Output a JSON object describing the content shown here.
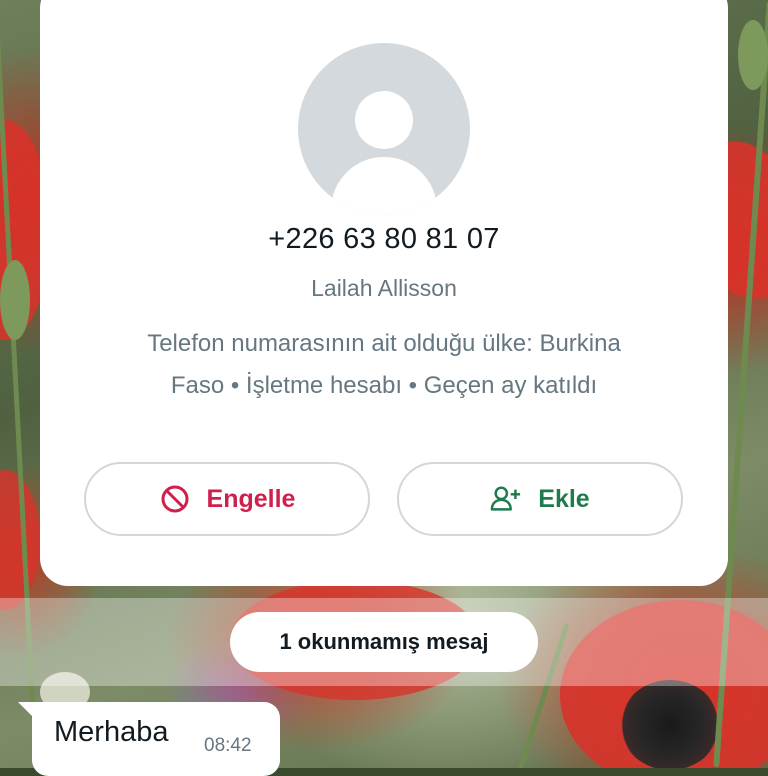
{
  "contact": {
    "phone": "+226 63 80 81 07",
    "push_name": "Lailah Allisson",
    "info_line_1": "Telefon numarasının ait olduğu ülke: Burkina",
    "info_line_2": "Faso • İşletme hesabı • Geçen ay katıldı"
  },
  "actions": {
    "block_label": "Engelle",
    "block_icon": "block-icon",
    "add_label": "Ekle",
    "add_icon": "person-add-icon"
  },
  "unread_banner": {
    "text": "1 okunmamış mesaj"
  },
  "message": {
    "text": "Merhaba",
    "time": "08:42"
  },
  "colors": {
    "block": "#d11f4c",
    "add": "#1f7a4d",
    "secondary_text": "#667781",
    "primary_text": "#111b21"
  }
}
